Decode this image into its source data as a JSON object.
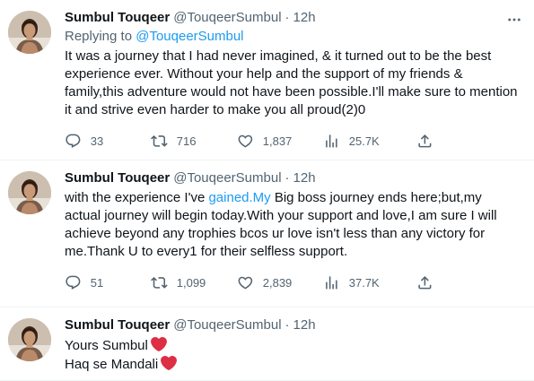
{
  "tweets": [
    {
      "name": "Sumbul Touqeer",
      "handle": "@TouqeerSumbul",
      "dot": "·",
      "time": "12h",
      "replying_prefix": "Replying to ",
      "replying_to": "@TouqeerSumbul",
      "text": "It was a journey that I had never imagined, & it turned out to be the best experience ever. Without your help and the support of my friends & family,this adventure would not have been possible.I'll make sure to mention it and strive even harder to make you all proud(2)0",
      "replies": "33",
      "retweets": "716",
      "likes": "1,837",
      "views": "25.7K"
    },
    {
      "name": "Sumbul Touqeer",
      "handle": "@TouqeerSumbul",
      "dot": "·",
      "time": "12h",
      "text_before": "with the experience I've ",
      "text_link": "gained.My",
      "text_after": " Big boss journey ends here;but,my actual journey will begin today.With your support and love,I am sure I will achieve beyond any trophies bcos ur love isn't less than any victory for me.Thank U to every1 for their selfless support.",
      "replies": "51",
      "retweets": "1,099",
      "likes": "2,839",
      "views": "37.7K"
    },
    {
      "name": "Sumbul Touqeer",
      "handle": "@TouqeerSumbul",
      "dot": "·",
      "time": "12h",
      "line1": "Yours Sumbul",
      "line2": "Haq se Mandali"
    }
  ],
  "icons": {
    "reply": "comment-icon",
    "retweet": "retweet-icon",
    "like": "heart-icon",
    "views": "analytics-icon",
    "share": "share-icon",
    "more": "more-icon",
    "emoji": "red-heart-emoji"
  },
  "colors": {
    "link": "#1d9bf0",
    "secondary": "#536471",
    "heart": "#e0245e"
  }
}
